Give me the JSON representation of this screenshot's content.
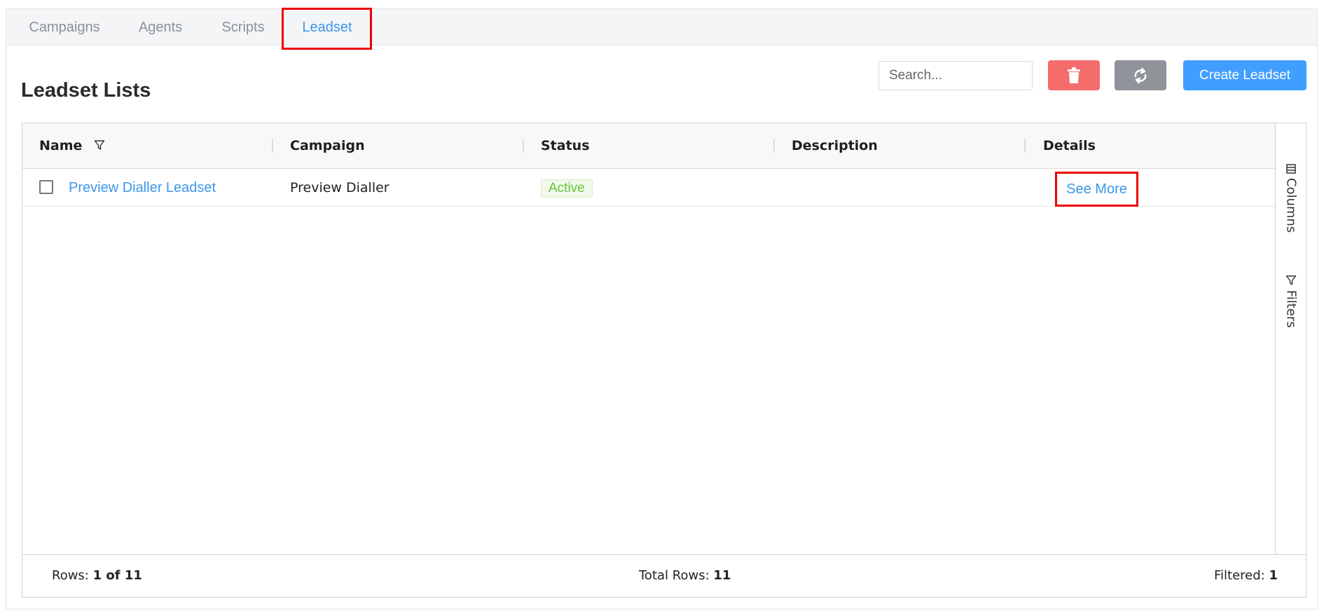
{
  "tabs": [
    {
      "label": "Campaigns",
      "active": false
    },
    {
      "label": "Agents",
      "active": false
    },
    {
      "label": "Scripts",
      "active": false
    },
    {
      "label": "Leadset",
      "active": true
    }
  ],
  "page": {
    "title": "Leadset Lists"
  },
  "toolbar": {
    "search_placeholder": "Search...",
    "delete_icon": "trash-icon",
    "refresh_icon": "refresh-icon",
    "create_label": "Create Leadset"
  },
  "grid": {
    "columns": [
      "Name",
      "Campaign",
      "Status",
      "Description",
      "Details"
    ],
    "rows": [
      {
        "name": "Preview Dialler Leadset",
        "campaign": "Preview Dialler",
        "status": "Active",
        "description": "",
        "details": "See More"
      }
    ],
    "side_tools": {
      "columns_label": "Columns",
      "filters_label": "Filters"
    },
    "status_bar": {
      "rows_label": "Rows:",
      "rows_value": "1 of 11",
      "total_label": "Total Rows:",
      "total_value": "11",
      "filtered_label": "Filtered:",
      "filtered_value": "1"
    }
  },
  "colors": {
    "accent": "#409eff",
    "danger": "#f56c6c",
    "neutral": "#909399",
    "success": "#67c23a",
    "highlight": "#ee0000"
  }
}
